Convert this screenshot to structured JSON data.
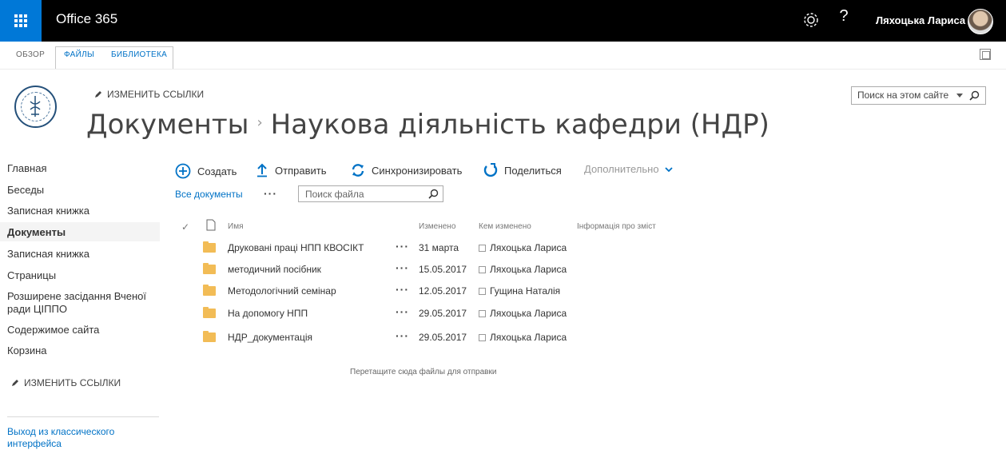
{
  "suite": {
    "brand": "Office 365",
    "help": "?",
    "user_name": "Ляхоцька Лариса",
    "accent": "#0078d7"
  },
  "ribbon": {
    "tabs": [
      "ОБЗОР",
      "ФАЙЛЫ",
      "БИБЛИОТЕКА"
    ]
  },
  "header": {
    "edit_links": "ИЗМЕНИТЬ ССЫЛКИ",
    "title_part1": "Документы",
    "title_sep": "›",
    "title_part2": "Наукова діяльність кафедри (НДР)",
    "site_search_placeholder": "Поиск на этом сайте"
  },
  "left_nav": {
    "items": [
      "Главная",
      "Беседы",
      "Записная книжка",
      "Документы",
      "Записная книжка",
      "Страницы",
      "Розширене засідання Вченої ради ЦІППО",
      "Содержимое сайта",
      "Корзина"
    ],
    "edit_links": "ИЗМЕНИТЬ ССЫЛКИ",
    "exit_classic": "Выход из классического интерфейса"
  },
  "commands": {
    "create": "Создать",
    "upload": "Отправить",
    "sync": "Синхронизировать",
    "share": "Поделиться",
    "more": "Дополнительно"
  },
  "view": {
    "all_docs": "Все документы",
    "more": "···",
    "file_search_placeholder": "Поиск файла"
  },
  "table": {
    "headers": {
      "check": "✓",
      "name": "Имя",
      "modified": "Изменено",
      "modified_by": "Кем изменено",
      "content_info": "Інформація про зміст"
    },
    "rows": [
      {
        "name": "Друковані праці НПП КВОСІКТ",
        "dots": "···",
        "modified": "31 марта",
        "user": "Ляхоцька Лариса"
      },
      {
        "name": "методичний посібник",
        "dots": "···",
        "modified": "15.05.2017",
        "user": "Ляхоцька Лариса"
      },
      {
        "name": "Методологічний семінар",
        "dots": "···",
        "modified": "12.05.2017",
        "user": "Гущина Наталія"
      },
      {
        "name": "На допомогу НПП",
        "dots": "···",
        "modified": "29.05.2017",
        "user": "Ляхоцька Лариса"
      },
      {
        "name": "НДР_документація",
        "dots": "···",
        "modified": "29.05.2017",
        "user": "Ляхоцька Лариса"
      }
    ],
    "drop_hint": "Перетащите сюда файлы для отправки"
  }
}
